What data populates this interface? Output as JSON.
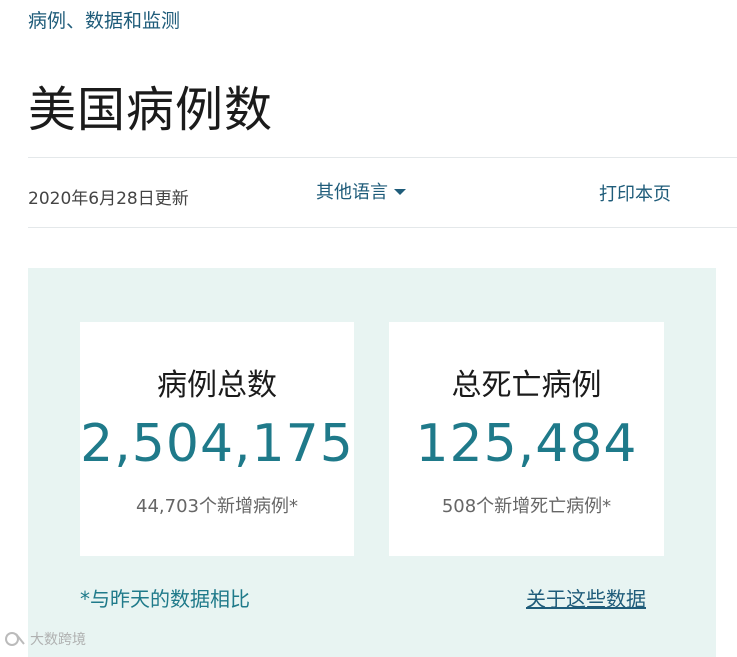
{
  "breadcrumb": "病例、数据和监测",
  "page_title": "美国病例数",
  "toolbar": {
    "updated": "2020年6月28日更新",
    "language_label": "其他语言",
    "print_label": "打印本页"
  },
  "cards": [
    {
      "title": "病例总数",
      "value": "2,504,175",
      "subtitle": "44,703个新增病例*"
    },
    {
      "title": "总死亡病例",
      "value": "125,484",
      "subtitle": "508个新增死亡病例*"
    }
  ],
  "footnote": "*与昨天的数据相比",
  "about_link": "关于这些数据",
  "watermark": "大数跨境",
  "colors": {
    "link": "#1f5c7a",
    "value": "#1f7a8a",
    "panel_bg": "#e8f4f2"
  },
  "icons": {
    "caret": "chevron-down-icon",
    "watermark": "watermark-logo-icon"
  }
}
